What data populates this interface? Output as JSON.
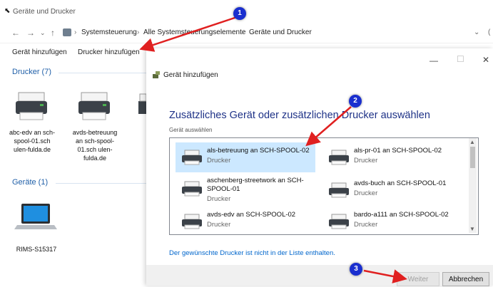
{
  "explorer": {
    "title": "Geräte und Drucker",
    "breadcrumb": [
      "Systemsteuerung",
      "Alle Systemsteuerungselemente",
      "Geräte und Drucker"
    ],
    "commands": [
      "Gerät hinzufügen",
      "Drucker hinzufügen"
    ],
    "printers_group": "Drucker (7)",
    "printers": [
      {
        "label": "abc-edv an sch-spool-01.sch ulen-fulda.de"
      },
      {
        "label": "avds-betreuung an sch-spool-01.sch ulen-fulda.de"
      }
    ],
    "devices_group": "Geräte (1)",
    "devices": [
      {
        "label": "RIMS-S15317"
      }
    ]
  },
  "dialog": {
    "title": "Gerät hinzufügen",
    "heading": "Zusätzliches Gerät oder zusätzlichen Drucker auswählen",
    "subheading": "Gerät auswählen",
    "printers": [
      {
        "name": "als-betreuung an SCH-SPOOL-02",
        "sub": "Drucker",
        "selected": true
      },
      {
        "name": "als-pr-01 an SCH-SPOOL-02",
        "sub": "Drucker",
        "selected": false
      },
      {
        "name": "aschenberg-streetwork an SCH-SPOOL-01",
        "sub": "Drucker",
        "selected": false
      },
      {
        "name": "avds-buch an SCH-SPOOL-01",
        "sub": "Drucker",
        "selected": false
      },
      {
        "name": "avds-edv an SCH-SPOOL-02",
        "sub": "Drucker",
        "selected": false
      },
      {
        "name": "bardo-a111 an SCH-SPOOL-02",
        "sub": "Drucker",
        "selected": false
      }
    ],
    "link": "Der gewünschte Drucker ist nicht in der Liste enthalten.",
    "next_button": "Weiter",
    "cancel_button": "Abbrechen"
  },
  "annotations": [
    "1",
    "2",
    "3"
  ],
  "colors": {
    "annotation_arrow": "#e02020",
    "badge": "#1a2fcf",
    "selection": "#cce8ff",
    "link": "#0066cc"
  }
}
